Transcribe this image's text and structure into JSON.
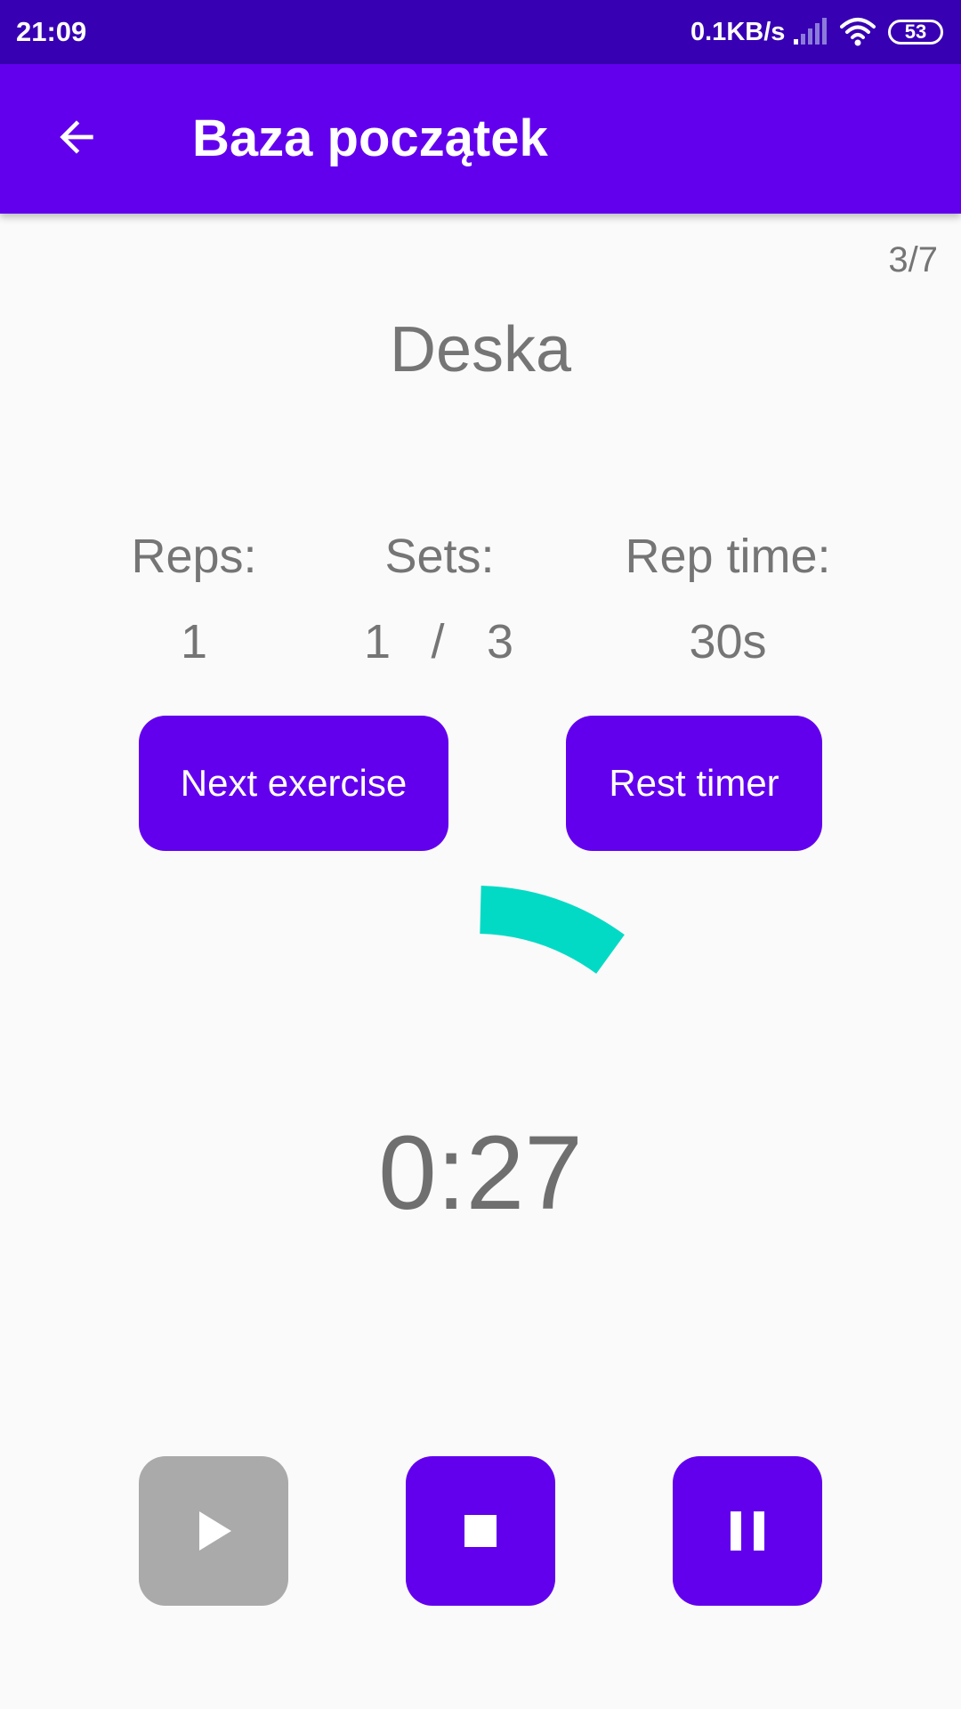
{
  "status_bar": {
    "time": "21:09",
    "network_speed": "0.1KB/s",
    "battery_level": "53"
  },
  "app_bar": {
    "title": "Baza początek",
    "back_icon": "arrow-back-icon"
  },
  "workout": {
    "progress": "3/7",
    "exercise_name": "Deska",
    "stats": {
      "reps_label": "Reps:",
      "reps_value": "1",
      "sets_label": "Sets:",
      "sets_current": "1",
      "sets_separator": "/",
      "sets_total": "3",
      "rep_time_label": "Rep time:",
      "rep_time_value": "30s"
    },
    "buttons": {
      "next_exercise": "Next exercise",
      "rest_timer": "Rest timer"
    },
    "timer": {
      "display": "0:27",
      "arc_color": "#03dac5"
    }
  },
  "controls": {
    "play": {
      "icon": "play-icon",
      "enabled": false,
      "color": "#aaaaaa"
    },
    "stop": {
      "icon": "stop-icon",
      "enabled": true,
      "color": "#6200ee"
    },
    "pause": {
      "icon": "pause-icon",
      "enabled": true,
      "color": "#6200ee"
    }
  },
  "colors": {
    "primary": "#6200ee",
    "primary_dark": "#3700b3",
    "accent": "#03dac5",
    "text_secondary": "#757575"
  }
}
